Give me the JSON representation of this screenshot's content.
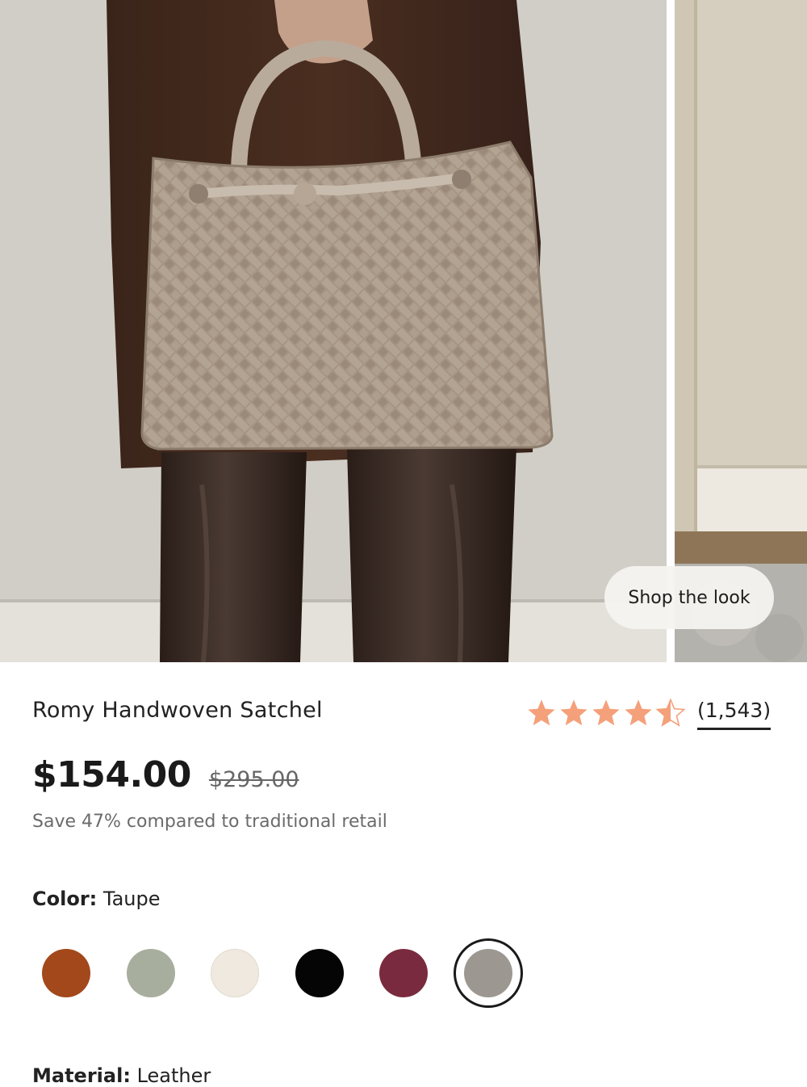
{
  "gallery": {
    "shop_the_look": "Shop the look"
  },
  "product": {
    "title": "Romy Handwoven Satchel",
    "rating_value": 4.5,
    "rating_max": 5,
    "review_count": "(1,543)",
    "price": "$154.00",
    "original_price": "$295.00",
    "savings_note": "Save 47% compared to traditional retail",
    "star_color": "#f4a07a"
  },
  "color": {
    "label": "Color:",
    "selected": "Taupe",
    "swatches": [
      {
        "hex": "#a3481b",
        "selected": false
      },
      {
        "hex": "#a7ae9e",
        "selected": false
      },
      {
        "hex": "#efe9df",
        "selected": false
      },
      {
        "hex": "#050505",
        "selected": false
      },
      {
        "hex": "#7a2a3e",
        "selected": false
      },
      {
        "hex": "#9c9891",
        "selected": true
      }
    ]
  },
  "material": {
    "label": "Material:",
    "value": "Leather"
  }
}
